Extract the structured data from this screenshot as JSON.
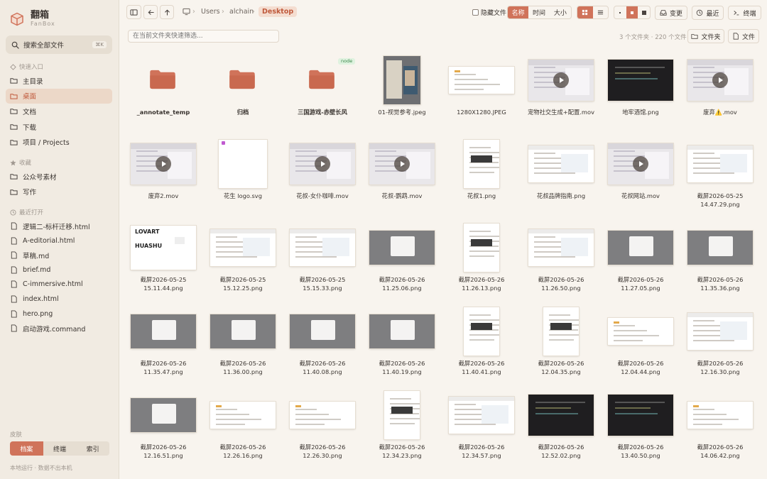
{
  "brand": {
    "title": "翻箱",
    "subtitle": "FanBox"
  },
  "sidebar": {
    "search_label": "搜索全部文件",
    "search_shortcut": "⌘K",
    "quick_title": "快速入口",
    "quick": [
      {
        "label": "主目录",
        "active": false
      },
      {
        "label": "桌面",
        "active": true
      },
      {
        "label": "文档",
        "active": false
      },
      {
        "label": "下载",
        "active": false
      },
      {
        "label": "项目 / Projects",
        "active": false
      }
    ],
    "fav_title": "收藏",
    "favorites": [
      "公众号素材",
      "写作"
    ],
    "recent_title": "最近打开",
    "recent": [
      "逻辑二-标杆迁移.html",
      "A-editorial.html",
      "草稿.md",
      "brief.md",
      "C-immersive.html",
      "index.html",
      "hero.png",
      "启动游戏.command"
    ],
    "skin_title": "皮肤",
    "skins": [
      "档案",
      "终端",
      "索引"
    ],
    "skin_active": 0,
    "footer": "本地运行 · 数据不出本机"
  },
  "toolbar": {
    "breadcrumb": [
      "Users",
      "alchain"
    ],
    "breadcrumb_current": "Desktop",
    "hidden_files": "隐藏文件",
    "sort": [
      "名称",
      "时间",
      "大小"
    ],
    "sort_active": 0,
    "change_label": "变更",
    "recent_label": "最近",
    "terminal_label": "终端",
    "filter_placeholder": "在当前文件夹快速筛选...",
    "count_text": "3 个文件夹 · 220 个文件",
    "new_folder_label": "文件夹",
    "new_file_label": "文件"
  },
  "files": [
    {
      "name": "_annotate_temp",
      "kind": "folder"
    },
    {
      "name": "归档",
      "kind": "folder"
    },
    {
      "name": "三国游戏-赤壁长风",
      "kind": "folder",
      "badge": "node"
    },
    {
      "name": "01-视觉参考.jpeg",
      "kind": "photo"
    },
    {
      "name": "1280X1280.JPEG",
      "kind": "doc"
    },
    {
      "name": "宠物社交生成+配置.mov",
      "kind": "video"
    },
    {
      "name": "地牢酒馆.png",
      "kind": "dark"
    },
    {
      "name": "废弃⚠️.mov",
      "kind": "video"
    },
    {
      "name": "废弃2.mov",
      "kind": "video"
    },
    {
      "name": "花生 logo.svg",
      "kind": "blank"
    },
    {
      "name": "花叔-女仆咖啡.mov",
      "kind": "video"
    },
    {
      "name": "花叔-鹦鹉.mov",
      "kind": "video"
    },
    {
      "name": "花叔1.png",
      "kind": "portrait"
    },
    {
      "name": "花叔品牌指南.png",
      "kind": "shot"
    },
    {
      "name": "花叔网站.mov",
      "kind": "video"
    },
    {
      "name": "截屏2026-05-25 14.47.29.png",
      "kind": "shot"
    },
    {
      "name": "截屏2026-05-25 15.11.44.png",
      "kind": "lovart"
    },
    {
      "name": "截屏2026-05-25 15.12.25.png",
      "kind": "shot"
    },
    {
      "name": "截屏2026-05-25 15.15.33.png",
      "kind": "shot"
    },
    {
      "name": "截屏2026-05-26 11.25.06.png",
      "kind": "grey"
    },
    {
      "name": "截屏2026-05-26 11.26.13.png",
      "kind": "portrait"
    },
    {
      "name": "截屏2026-05-26 11.26.50.png",
      "kind": "shot"
    },
    {
      "name": "截屏2026-05-26 11.27.05.png",
      "kind": "grey"
    },
    {
      "name": "截屏2026-05-26 11.35.36.png",
      "kind": "grey"
    },
    {
      "name": "截屏2026-05-26 11.35.47.png",
      "kind": "grey"
    },
    {
      "name": "截屏2026-05-26 11.36.00.png",
      "kind": "grey"
    },
    {
      "name": "截屏2026-05-26 11.40.08.png",
      "kind": "grey"
    },
    {
      "name": "截屏2026-05-26 11.40.19.png",
      "kind": "grey"
    },
    {
      "name": "截屏2026-05-26 11.40.41.png",
      "kind": "portrait"
    },
    {
      "name": "截屏2026-05-26 12.04.35.png",
      "kind": "portrait"
    },
    {
      "name": "截屏2026-05-26 12.04.44.png",
      "kind": "doc"
    },
    {
      "name": "截屏2026-05-26 12.16.30.png",
      "kind": "shot"
    },
    {
      "name": "截屏2026-05-26 12.16.51.png",
      "kind": "grey"
    },
    {
      "name": "截屏2026-05-26 12.26.16.png",
      "kind": "doc"
    },
    {
      "name": "截屏2026-05-26 12.26.30.png",
      "kind": "doc"
    },
    {
      "name": "截屏2026-05-26 12.34.23.png",
      "kind": "portrait"
    },
    {
      "name": "截屏2026-05-26 12.34.57.png",
      "kind": "shot"
    },
    {
      "name": "截屏2026-05-26 12.52.02.png",
      "kind": "dark"
    },
    {
      "name": "截屏2026-05-26 13.40.50.png",
      "kind": "dark"
    },
    {
      "name": "截屏2026-05-26 14.06.42.png",
      "kind": "doc"
    }
  ],
  "colors": {
    "accent": "#d0735a",
    "folder": "#d0735a",
    "sidebar_bg": "#f1ebe2",
    "page_bg": "#f8f4ee"
  }
}
